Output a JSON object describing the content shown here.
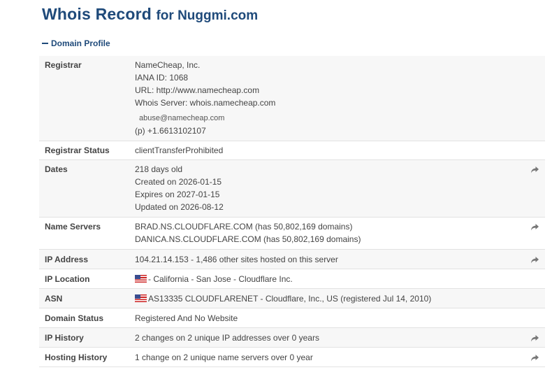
{
  "header": {
    "title": "Whois Record",
    "subtitle": "for Nuggmi.com"
  },
  "section": {
    "label": "Domain Profile"
  },
  "rows": {
    "registrar": {
      "label": "Registrar",
      "name": "NameCheap, Inc.",
      "iana": "IANA ID: 1068",
      "url": "URL: http://www.namecheap.com",
      "whois": "Whois Server: whois.namecheap.com",
      "abuse": "abuse@namecheap.com",
      "phone": "(p) +1.6613102107"
    },
    "registrar_status": {
      "label": "Registrar Status",
      "value": "clientTransferProhibited"
    },
    "dates": {
      "label": "Dates",
      "age": "218 days old",
      "created": "Created on 2026-01-15",
      "expires": "Expires on 2027-01-15",
      "updated": "Updated on 2026-08-12"
    },
    "name_servers": {
      "label": "Name Servers",
      "ns1": "BRAD.NS.CLOUDFLARE.COM (has 50,802,169 domains)",
      "ns2": "DANICA.NS.CLOUDFLARE.COM (has 50,802,169 domains)"
    },
    "ip_address": {
      "label": "IP Address",
      "value": "104.21.14.153 - 1,486 other sites hosted on this server"
    },
    "ip_location": {
      "label": "IP Location",
      "value": "- California - San Jose - Cloudflare Inc.",
      "flag": "us-flag-icon"
    },
    "asn": {
      "label": "ASN",
      "value": "AS13335 CLOUDFLARENET - Cloudflare, Inc., US (registered Jul 14, 2010)",
      "flag": "us-flag-icon"
    },
    "domain_status": {
      "label": "Domain Status",
      "value": "Registered And No Website"
    },
    "ip_history": {
      "label": "IP History",
      "value": "2 changes on 2 unique IP addresses over 0 years"
    },
    "hosting_history": {
      "label": "Hosting History",
      "value": "1 change on 2 unique name servers over 0 year"
    }
  },
  "icons": {
    "action": "share-arrow-icon",
    "collapse": "minus-icon"
  },
  "colors": {
    "heading": "#1f4a7a",
    "row_alt": "#f7f7f7",
    "border": "#e2e2e2"
  }
}
